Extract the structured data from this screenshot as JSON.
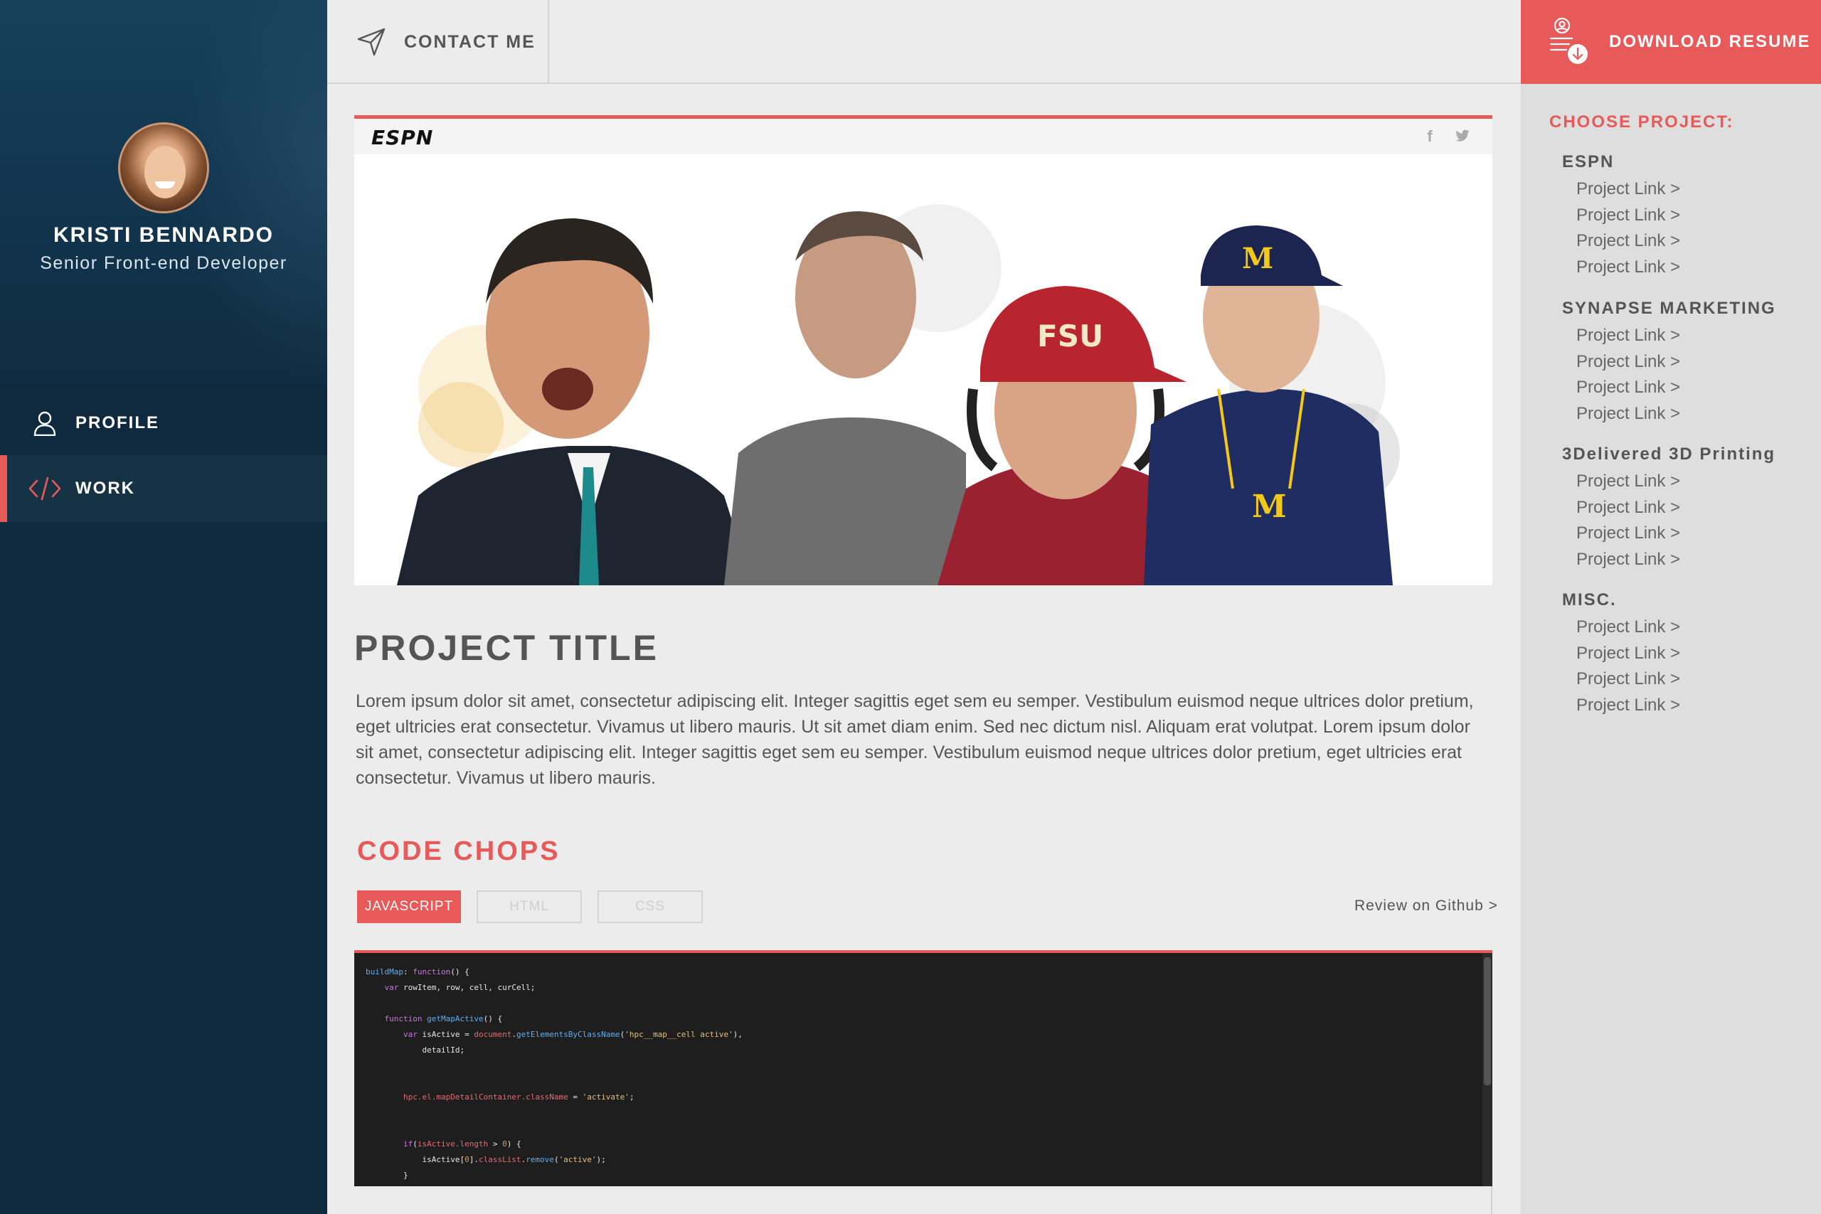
{
  "sidebar": {
    "name": "KRISTI BENNARDO",
    "role": "Senior Front-end Developer",
    "nav": [
      {
        "label": "PROFILE",
        "icon": "user-icon"
      },
      {
        "label": "WORK",
        "icon": "code-icon",
        "active": true
      }
    ]
  },
  "topbar": {
    "contact_label": "CONTACT ME",
    "download_label": "DOWNLOAD RESUME"
  },
  "projects_panel": {
    "title": "CHOOSE PROJECT:",
    "groups": [
      {
        "title": "ESPN",
        "links": [
          "Project Link >",
          "Project Link >",
          "Project Link >",
          "Project Link >"
        ]
      },
      {
        "title": "SYNAPSE MARKETING",
        "links": [
          "Project Link >",
          "Project Link >",
          "Project Link >",
          "Project Link >"
        ]
      },
      {
        "title": "3Delivered 3D Printing",
        "links": [
          "Project Link >",
          "Project Link >",
          "Project Link >",
          "Project Link >"
        ]
      },
      {
        "title": "MISC.",
        "links": [
          "Project Link >",
          "Project Link >",
          "Project Link >",
          "Project Link >"
        ]
      }
    ]
  },
  "hero": {
    "brand": "ESPN"
  },
  "project": {
    "title": "PROJECT TITLE",
    "description": "Lorem ipsum dolor sit amet, consectetur adipiscing elit. Integer sagittis eget sem eu semper. Vestibulum euismod neque ultrices dolor pretium, eget ultricies erat consectetur. Vivamus ut libero mauris. Ut sit amet diam enim. Sed nec dictum nisl. Aliquam erat volutpat. Lorem ipsum dolor sit amet, consectetur adipiscing elit. Integer sagittis eget sem eu semper. Vestibulum euismod neque ultrices dolor pretium, eget ultricies erat consectetur. Vivamus ut libero mauris."
  },
  "code_chops": {
    "title": "CODE CHOPS",
    "tabs": [
      "JAVASCRIPT",
      "HTML",
      "CSS"
    ],
    "active_tab": "JAVASCRIPT",
    "github_link": "Review on Github >"
  },
  "colors": {
    "accent": "#e85a5a",
    "sidebar_bg": "#0f2a3e",
    "page_bg": "#ececec",
    "right_panel_bg": "#dedede"
  }
}
